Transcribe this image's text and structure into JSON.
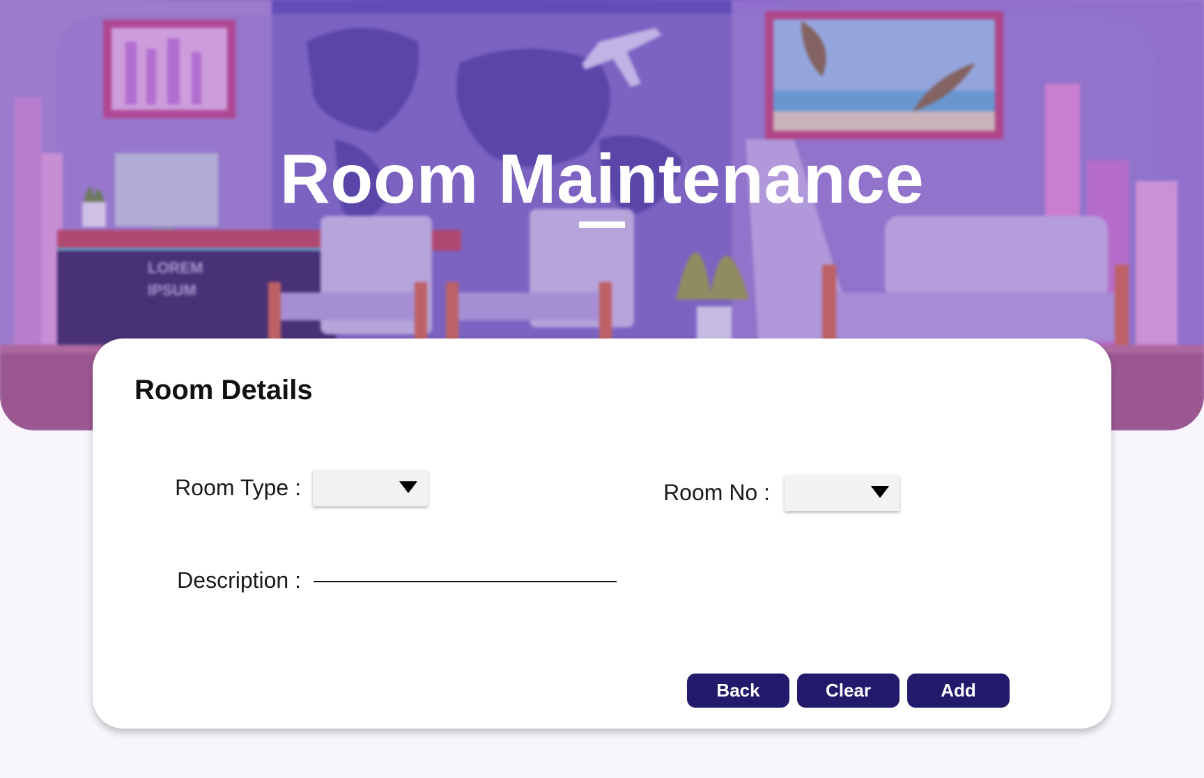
{
  "header": {
    "title": "Room Maintenance"
  },
  "form": {
    "title": "Room Details",
    "room_type": {
      "label": "Room Type :",
      "selected": ""
    },
    "room_no": {
      "label": "Room No :",
      "selected": ""
    },
    "description": {
      "label": "Description :",
      "value": "",
      "placeholder": ""
    }
  },
  "buttons": {
    "back": "Back",
    "clear": "Clear",
    "add": "Add"
  },
  "colors": {
    "button_bg": "#221a6b",
    "hero_purple": "#6b58bd",
    "card_bg": "#ffffff",
    "page_bg": "#f8f5fc"
  },
  "icons": {
    "dropdown": "caret-down-icon"
  }
}
